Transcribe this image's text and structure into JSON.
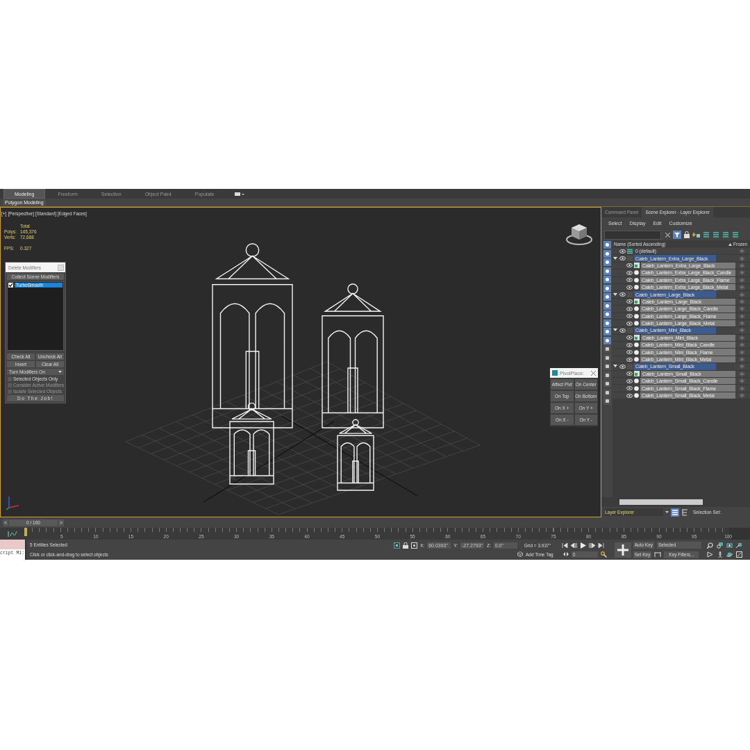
{
  "ribbon": {
    "tabs": [
      {
        "label": "Modeling",
        "selected": true
      },
      {
        "label": "Freeform",
        "selected": false
      },
      {
        "label": "Selection",
        "selected": false
      },
      {
        "label": "Object Paint",
        "selected": false
      },
      {
        "label": "Populate",
        "selected": false
      }
    ],
    "panel_label": "Polygon Modeling"
  },
  "viewport": {
    "labels": [
      "[+]",
      "[Perspective]",
      "[Standard]",
      "[Edged Faces]"
    ],
    "stats": {
      "heading": "Total",
      "rows": [
        {
          "label": "Polys:",
          "value": "145,376"
        },
        {
          "label": "Verts:",
          "value": "72,688"
        }
      ],
      "fps_label": "FPS:",
      "fps_value": "0.327"
    }
  },
  "delete_modifiers": {
    "title": "Delete Modifiers",
    "collect_button": "Collect Scene Modifiers",
    "modifiers": [
      {
        "label": "TurboSmooth",
        "checked": true,
        "selected": true
      }
    ],
    "buttons": [
      "Check All",
      "Uncheck All",
      "Invert",
      "Clear All"
    ],
    "mode": "Turn Modifiers On",
    "options": [
      {
        "label": "Selected Objects Only",
        "checked": false,
        "disabled": false
      },
      {
        "label": "Consider Active Modifiers",
        "checked": false,
        "disabled": true
      },
      {
        "label": "Isolate Selected Objects",
        "checked": false,
        "disabled": true
      }
    ],
    "run_button": "Do The Job!"
  },
  "pivot_place": {
    "title": "PivotPlace:",
    "buttons": [
      "Affect Pivt",
      "On Center",
      "On Top",
      "On Bottom",
      "On X +",
      "On Y +",
      "On X -",
      "On Y -"
    ]
  },
  "scene_explorer": {
    "tabs": [
      {
        "label": "Command Panel",
        "selected": false
      },
      {
        "label": "Scene Explorer - Layer Explorer",
        "selected": true
      }
    ],
    "menu": [
      "Select",
      "Display",
      "Edit",
      "Customize"
    ],
    "filter_toggles": [
      {
        "on": true
      },
      {
        "on": true
      },
      {
        "on": true
      },
      {
        "on": true
      },
      {
        "on": true
      },
      {
        "on": true
      },
      {
        "on": true
      },
      {
        "on": true
      },
      {
        "on": true
      },
      {
        "on": true
      },
      {
        "on": true
      },
      {
        "on": true
      },
      {
        "on": false
      },
      {
        "on": false
      },
      {
        "on": false
      },
      {
        "on": false
      },
      {
        "on": false
      },
      {
        "on": false
      },
      {
        "on": false
      }
    ],
    "columns": {
      "name": "Name (Sorted Ascending)",
      "frozen": "Frozen"
    },
    "layers": [
      {
        "name": "0 (default)",
        "current": true,
        "selected": false
      },
      {
        "name": "Caleb_Lantern_Extra_Large_Black",
        "current": false,
        "selected": true,
        "expanded": true,
        "children": [
          {
            "name": "Caleb_Lantern_Extra_Large_Black",
            "kind": "group",
            "selected": true
          },
          {
            "name": "Caleb_Lantern_Extra_Large_Black_Candle",
            "kind": "object",
            "selected": true
          },
          {
            "name": "Caleb_Lantern_Extra_Large_Black_Flame",
            "kind": "object",
            "selected": true
          },
          {
            "name": "Caleb_Lantern_Extra_Large_Black_Metal",
            "kind": "object",
            "selected": true
          }
        ]
      },
      {
        "name": "Caleb_Lantern_Large_Black",
        "current": false,
        "selected": true,
        "expanded": true,
        "children": [
          {
            "name": "Caleb_Lantern_Large_Black",
            "kind": "group",
            "selected": true
          },
          {
            "name": "Caleb_Lantern_Large_Black_Candle",
            "kind": "object",
            "selected": true
          },
          {
            "name": "Caleb_Lantern_Large_Black_Flame",
            "kind": "object",
            "selected": true
          },
          {
            "name": "Caleb_Lantern_Large_Black_Metal",
            "kind": "object",
            "selected": true
          }
        ]
      },
      {
        "name": "Caleb_Lantern_Mini_Black",
        "current": false,
        "selected": true,
        "expanded": true,
        "children": [
          {
            "name": "Caleb_Lantern_Mini_Black",
            "kind": "group",
            "selected": true
          },
          {
            "name": "Caleb_Lantern_Mini_Black_Candle",
            "kind": "object",
            "selected": true
          },
          {
            "name": "Caleb_Lantern_Mini_Black_Flame",
            "kind": "object",
            "selected": true
          },
          {
            "name": "Caleb_Lantern_Mini_Black_Metal",
            "kind": "object",
            "selected": true
          }
        ]
      },
      {
        "name": "Caleb_Lantern_Small_Black",
        "current": false,
        "selected": true,
        "expanded": true,
        "children": [
          {
            "name": "Caleb_Lantern_Small_Black",
            "kind": "group",
            "selected": true
          },
          {
            "name": "Caleb_Lantern_Small_Black_Candle",
            "kind": "object",
            "selected": true
          },
          {
            "name": "Caleb_Lantern_Small_Black_Flame",
            "kind": "object",
            "selected": true
          },
          {
            "name": "Caleb_Lantern_Small_Black_Metal",
            "kind": "object",
            "selected": true
          }
        ]
      }
    ],
    "layer_dropdown": "Layer Explorer",
    "selection_set_label": "Selection Set:"
  },
  "time_slider": {
    "prev": "<",
    "position": "0 / 100",
    "next": ">"
  },
  "timeline": {
    "ticks": [
      "5",
      "10",
      "15",
      "20",
      "25",
      "30",
      "35",
      "40",
      "45",
      "50",
      "55",
      "60",
      "65",
      "70",
      "75",
      "80",
      "85",
      "90",
      "95",
      "100"
    ]
  },
  "status": {
    "script_label": "cript Mi:",
    "message": "5 Entities Selected",
    "prompt": "Click or click-and-drag to select objects"
  },
  "transform": {
    "x_label": "X:",
    "x": "60.0393\"",
    "y_label": "Y:",
    "y": "-27.2793\"",
    "z_label": "Z:",
    "z": "0.0\"",
    "grid": "Grid = 3.937\"",
    "time_tag": "Add Time Tag"
  },
  "animation": {
    "auto_key": "Auto Key",
    "key_mode": "Selected",
    "set_key": "Set Key",
    "frame": "0",
    "key_filters": "Key Filters..."
  }
}
